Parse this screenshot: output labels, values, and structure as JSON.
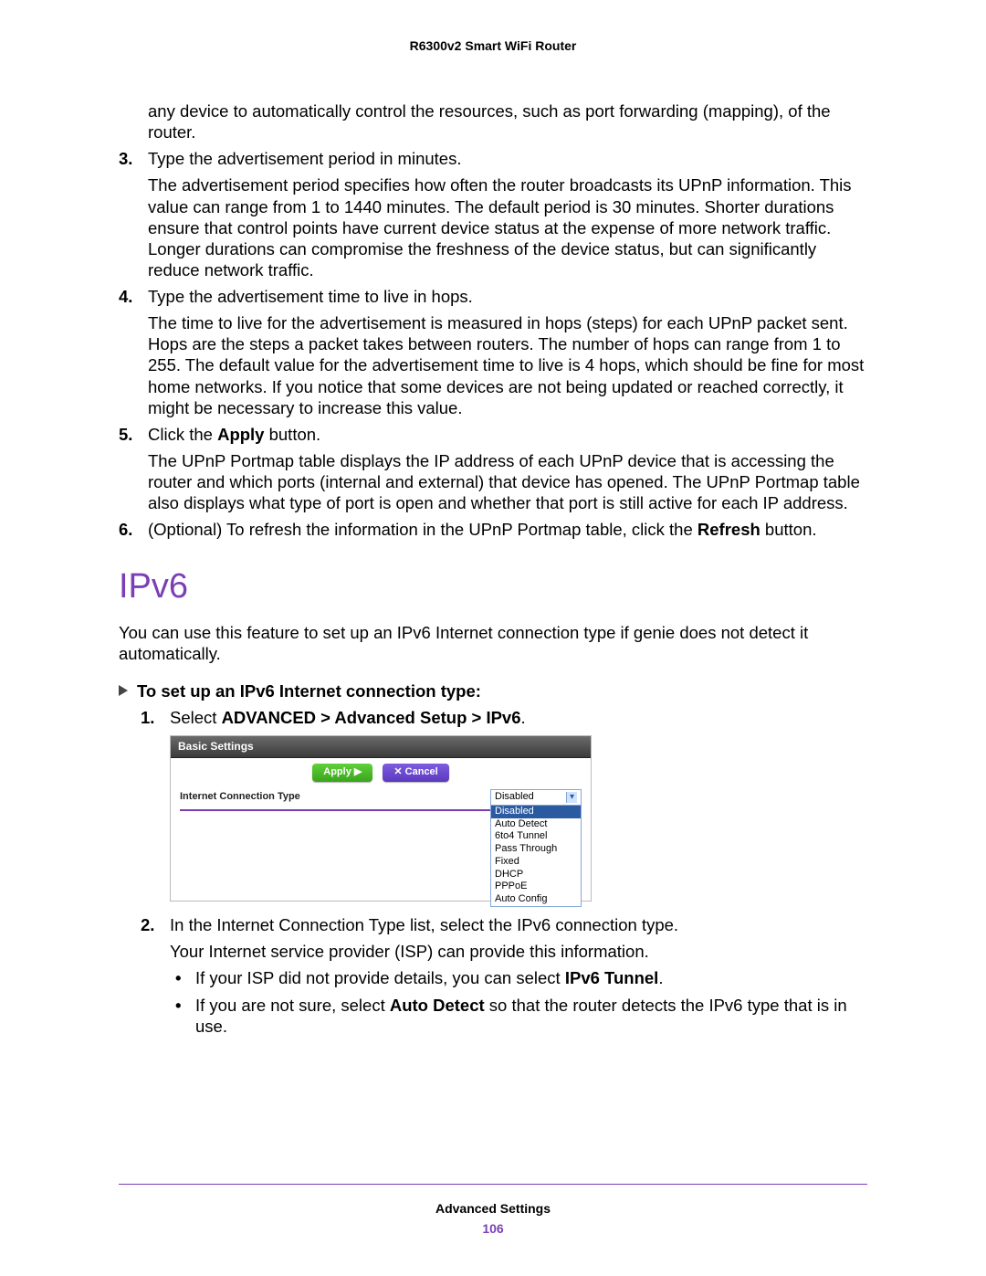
{
  "header": {
    "product": "R6300v2 Smart WiFi Router"
  },
  "intro_continuation": "any device to automatically control the resources, such as port forwarding (mapping), of the router.",
  "steps_a": [
    {
      "num": "3.",
      "lead": "Type the advertisement period in minutes.",
      "detail": "The advertisement period specifies how often the router broadcasts its UPnP information. This value can range from 1 to 1440 minutes. The default period is 30 minutes. Shorter durations ensure that control points have current device status at the expense of more network traffic. Longer durations can compromise the freshness of the device status, but can significantly reduce network traffic."
    },
    {
      "num": "4.",
      "lead": "Type the advertisement time to live in hops.",
      "detail": "The time to live for the advertisement is measured in hops (steps) for each UPnP packet sent. Hops are the steps a packet takes between routers. The number of hops can range from 1 to 255. The default value for the advertisement time to live is 4 hops, which should be fine for most home networks. If you notice that some devices are not being updated or reached correctly, it might be necessary to increase this value."
    },
    {
      "num": "5.",
      "lead_parts": [
        "Click the ",
        "Apply",
        " button."
      ],
      "detail": "The UPnP Portmap table displays the IP address of each UPnP device that is accessing the router and which ports (internal and external) that device has opened. The UPnP Portmap table also displays what type of port is open and whether that port is still active for each IP address."
    },
    {
      "num": "6.",
      "lead_parts": [
        "(Optional) To refresh the information in the UPnP Portmap table, click the ",
        "Refresh",
        " button."
      ]
    }
  ],
  "section": {
    "heading": "IPv6",
    "intro": "You can use this feature to set up an IPv6 Internet connection type if genie does not detect it automatically.",
    "task": "To set up an IPv6 Internet connection type:",
    "steps": [
      {
        "num": "1.",
        "lead_parts": [
          "Select ",
          "ADVANCED > Advanced Setup > IPv6",
          "."
        ]
      },
      {
        "num": "2.",
        "lead": "In the Internet Connection Type list, select the IPv6 connection type.",
        "detail": "Your Internet service provider (ISP) can provide this information.",
        "bullets": [
          {
            "parts": [
              "If your ISP did not provide details, you can select ",
              "IPv6 Tunnel",
              "."
            ]
          },
          {
            "parts": [
              "If you are not sure, select ",
              "Auto Detect",
              " so that the router detects the IPv6 type that is in use."
            ]
          }
        ]
      }
    ]
  },
  "ui": {
    "title": "Basic Settings",
    "apply": "Apply ▶",
    "cancel": "✕ Cancel",
    "row_label": "Internet Connection Type",
    "selected": "Disabled",
    "options": [
      "Disabled",
      "Auto Detect",
      "6to4 Tunnel",
      "Pass Through",
      "Fixed",
      "DHCP",
      "PPPoE",
      "Auto Config"
    ]
  },
  "footer": {
    "section": "Advanced Settings",
    "page": "106"
  }
}
